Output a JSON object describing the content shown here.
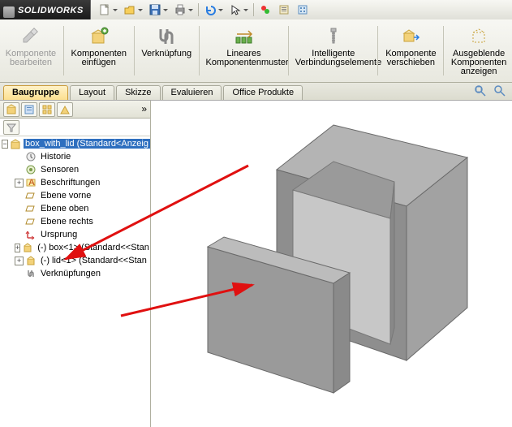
{
  "app": {
    "name": "SOLIDWORKS"
  },
  "qat": {
    "new": "new",
    "open": "open",
    "save": "save",
    "print": "print",
    "undo": "undo",
    "select": "select",
    "rebuild": "rebuild",
    "options": "options",
    "doc_props": "doc_props"
  },
  "ribbon": {
    "edit_component": "Komponente\nbearbeiten",
    "insert_component": "Komponenten\neinfügen",
    "mate": "Verknüpfung",
    "linear_pattern": "Lineares\nKomponentenmuster",
    "smart_fasteners": "Intelligente\nVerbindungselemente",
    "move_component": "Komponente\nverschieben",
    "hidden_components": "Ausgeblende\nKomponenten\nanzeigen"
  },
  "tabs": {
    "assembly": "Baugruppe",
    "layout": "Layout",
    "sketch": "Skizze",
    "evaluate": "Evaluieren",
    "office": "Office Produkte"
  },
  "view_icons": {
    "zoom_fit": "zoom-fit",
    "zoom_area": "zoom-area"
  },
  "panel_tabs": {
    "feature_mgr": "feature-manager",
    "property_mgr": "property-manager",
    "config_mgr": "configuration-manager",
    "dim_mgr": "dimxpert-manager"
  },
  "filter": {
    "label": "filter"
  },
  "tree": {
    "root": "box_with_lid  (Standard<Anzeig",
    "history": "Historie",
    "sensors": "Sensoren",
    "annotations": "Beschriftungen",
    "front_plane": "Ebene vorne",
    "top_plane": "Ebene oben",
    "right_plane": "Ebene rechts",
    "origin": "Ursprung",
    "part1": "(-) box<1> (Standard<<Stan",
    "part2": "(-) lid<1> (Standard<<Stan",
    "mates": "Verknüpfungen"
  }
}
